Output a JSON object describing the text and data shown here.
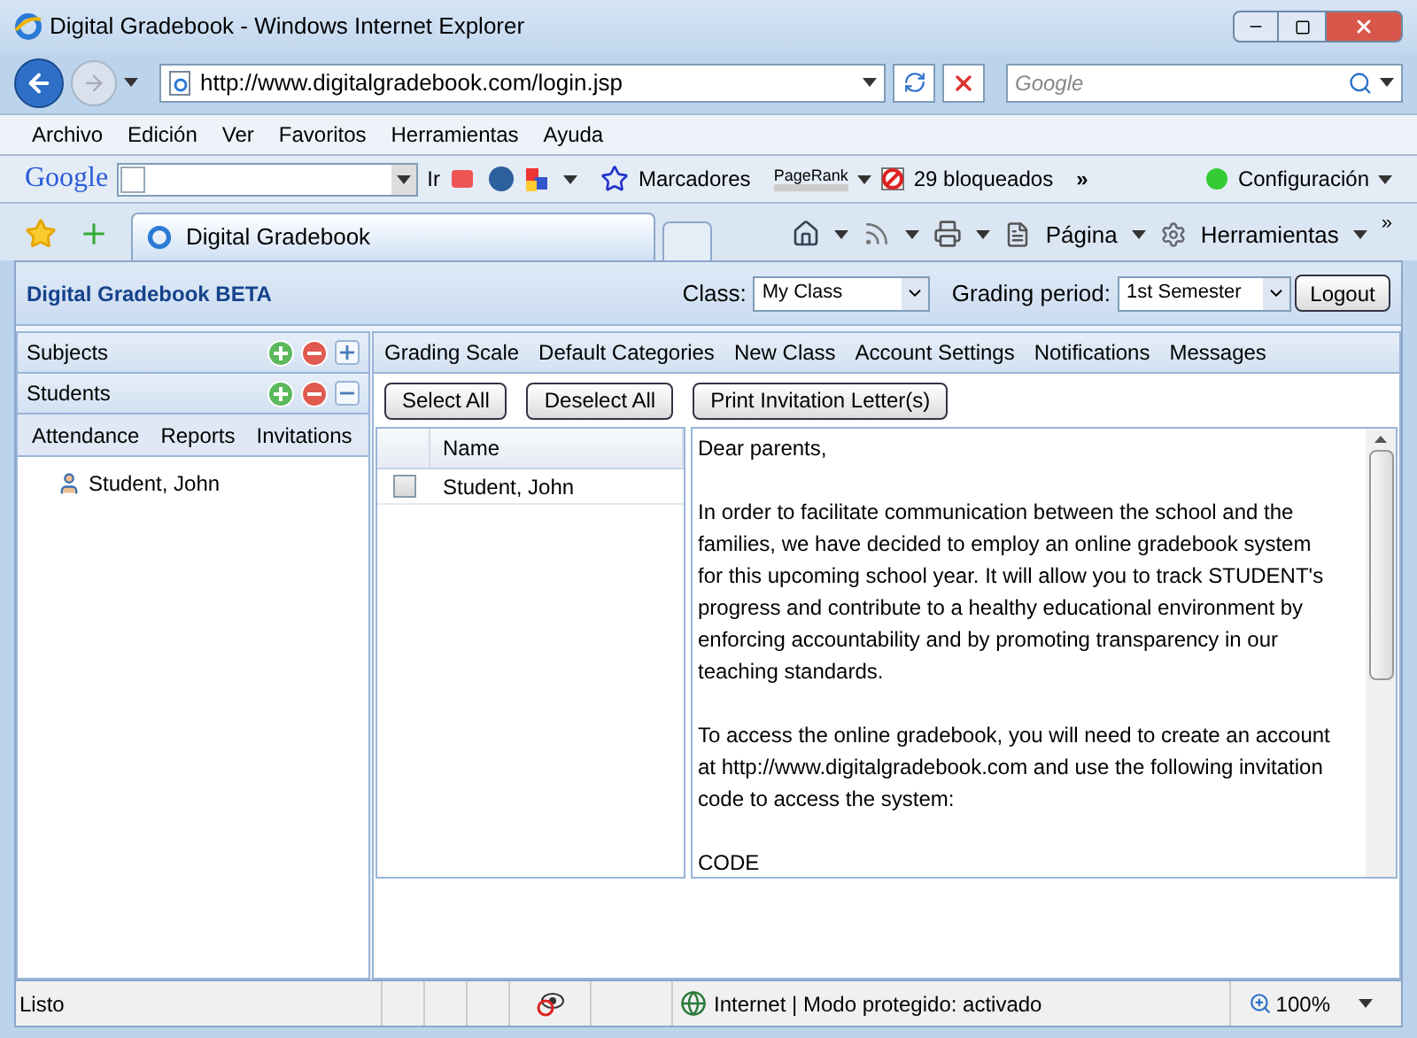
{
  "window": {
    "title": "Digital Gradebook - Windows Internet Explorer"
  },
  "address_bar": {
    "url": "http://www.digitalgradebook.com/login.jsp"
  },
  "search": {
    "placeholder": "Google"
  },
  "menu": [
    "Archivo",
    "Edición",
    "Ver",
    "Favoritos",
    "Herramientas",
    "Ayuda"
  ],
  "google_toolbar": {
    "logo": "Google",
    "go": "Ir",
    "bookmarks": "Marcadores",
    "pagerank": "PageRank",
    "blocked": "29 bloqueados",
    "more": "»",
    "settings": "Configuración"
  },
  "tabs": [
    {
      "label": "Digital Gradebook",
      "selected": true
    }
  ],
  "command_bar": {
    "page": "Página",
    "tools": "Herramientas",
    "more": "»"
  },
  "app": {
    "title": "Digital Gradebook BETA",
    "class_label": "Class:",
    "class_value": "My Class",
    "period_label": "Grading period:",
    "period_value": "1st Semester",
    "logout": "Logout"
  },
  "sidebar": {
    "sections": [
      {
        "label": "Subjects",
        "expanded": false
      },
      {
        "label": "Students",
        "expanded": true
      }
    ],
    "tabs": [
      "Attendance",
      "Reports",
      "Invitations"
    ],
    "students": [
      "Student, John"
    ]
  },
  "nav": [
    "Grading Scale",
    "Default Categories",
    "New Class",
    "Account Settings",
    "Notifications",
    "Messages"
  ],
  "actions": [
    "Select All",
    "Deselect All",
    "Print Invitation Letter(s)"
  ],
  "table": {
    "columns": [
      "Name"
    ],
    "rows": [
      {
        "name": "Student, John",
        "checked": false
      }
    ]
  },
  "letter": {
    "paragraphs": [
      "Dear parents,",
      "In order to facilitate communication between the school and the families, we have decided to employ an online gradebook system for this upcoming school year. It will allow you to track STUDENT's progress and contribute to a healthy educational environment by enforcing accountability and by promoting transparency in our teaching standards.",
      "To access the online gradebook, you will need to create an account at http://www.digitalgradebook.com and use the following invitation code to access the system:",
      "CODE"
    ]
  },
  "status_bar": {
    "status": "Listo",
    "zone": "Internet | Modo protegido: activado",
    "zoom": "100%"
  }
}
